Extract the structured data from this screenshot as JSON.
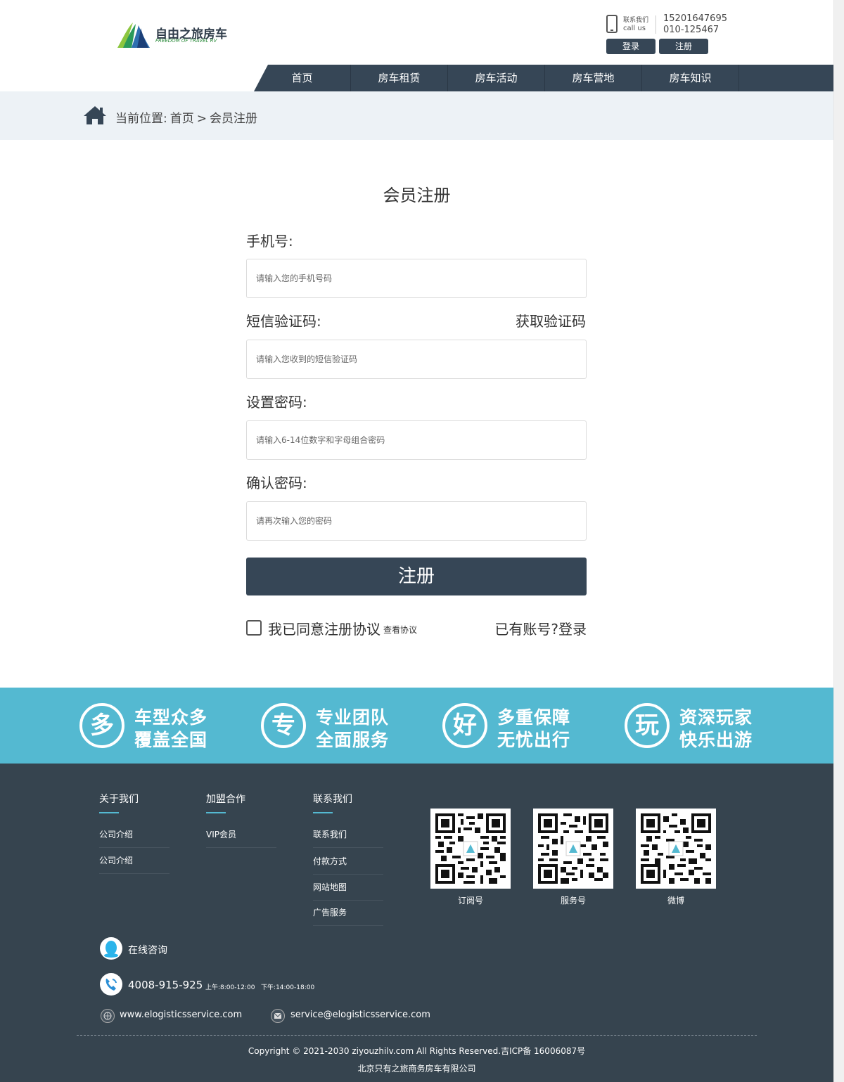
{
  "header": {
    "logo_title": "自由之旅房车",
    "logo_subtitle": "FREEDOM OF TRAVEL RV",
    "contact_label_cn": "联系我们",
    "contact_label_en": "call us",
    "phone_1": "15201647695",
    "phone_2": "010-125467",
    "login_label": "登录",
    "register_label": "注册"
  },
  "nav": {
    "items": [
      {
        "label": "首页"
      },
      {
        "label": "房车租赁"
      },
      {
        "label": "房车活动"
      },
      {
        "label": "房车营地"
      },
      {
        "label": "房车知识"
      }
    ]
  },
  "breadcrumb": {
    "prefix": "当前位置:",
    "home": "首页",
    "separator": ">",
    "current": "会员注册"
  },
  "form": {
    "title": "会员注册",
    "phone_label": "手机号:",
    "phone_placeholder": "请输入您的手机号码",
    "sms_label": "短信验证码:",
    "get_code_label": "获取验证码",
    "sms_placeholder": "请输入您收到的短信验证码",
    "password_label": "设置密码:",
    "password_placeholder": "请输入6-14位数字和字母组合密码",
    "confirm_label": "确认密码:",
    "confirm_placeholder": "请再次输入您的密码",
    "submit_label": "注册",
    "agree_text": "我已同意注册协议",
    "agree_link": "查看协议",
    "has_account": "已有账号?登录"
  },
  "features": [
    {
      "glyph": "多",
      "line1": "车型众多",
      "line2": "覆盖全国"
    },
    {
      "glyph": "专",
      "line1": "专业团队",
      "line2": "全面服务"
    },
    {
      "glyph": "好",
      "line1": "多重保障",
      "line2": "无忧出行"
    },
    {
      "glyph": "玩",
      "line1": "资深玩家",
      "line2": "快乐出游"
    }
  ],
  "footer": {
    "columns": [
      {
        "title": "关于我们",
        "links": [
          "公司介绍",
          "公司介绍"
        ]
      },
      {
        "title": "加盟合作",
        "links": [
          "VIP会员"
        ]
      },
      {
        "title": "联系我们",
        "links": [
          "联系我们",
          "付款方式",
          "网站地图",
          "广告服务"
        ]
      }
    ],
    "qr_codes": [
      {
        "label": "订阅号"
      },
      {
        "label": "服务号"
      },
      {
        "label": "微博"
      }
    ],
    "online_consult": "在线咨询",
    "hotline": "4008-915-925",
    "hours_am": "上午:8:00-12:00",
    "hours_pm": "下午:14:00-18:00",
    "website": "www.elogisticsservice.com",
    "email": "service@elogisticsservice.com",
    "copyright": "Copyright © 2021-2030 ziyouzhilv.com All Rights Reserved.吉ICP备 16006087号",
    "company": "北京只有之旅商务房车有限公司"
  },
  "colors": {
    "nav_bg": "#364656",
    "feature_band": "#54b9d1",
    "footer_bg": "#36444f",
    "breadcrumb_bg": "#edf2f6"
  },
  "icons": {
    "home": "home-icon",
    "phone": "phone-icon",
    "qq": "qq-icon",
    "hotline": "headset-phone-icon",
    "web": "globe-icon",
    "mail": "mail-icon"
  }
}
